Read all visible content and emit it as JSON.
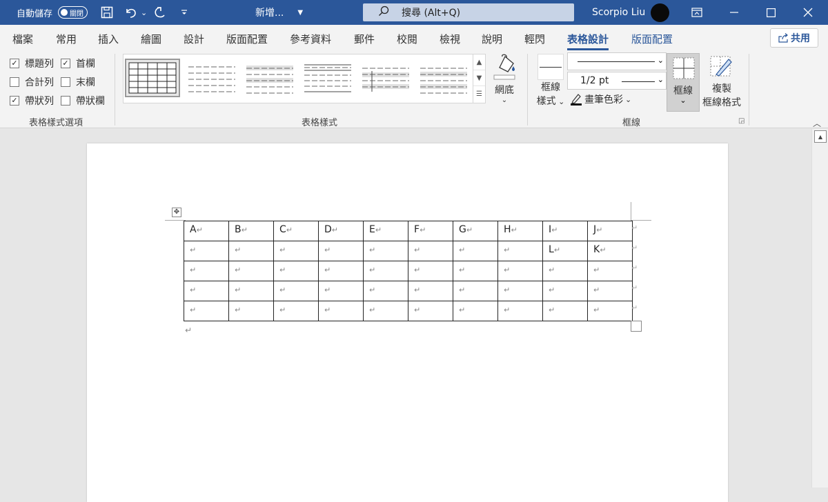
{
  "titlebar": {
    "autosave_label": "自動儲存",
    "autosave_toggle": "關閉",
    "document_name": "新增...",
    "search_placeholder": "搜尋 (Alt+Q)",
    "user_name": "Scorpio Liu",
    "icons": {
      "save": "save-icon",
      "undo": "undo-icon",
      "redo": "redo-icon",
      "minimize": "minimize-icon",
      "maximize": "maximize-icon",
      "close": "close-icon",
      "ribbon_options": "ribbon-display-icon"
    }
  },
  "tabs": [
    {
      "label": "檔案"
    },
    {
      "label": "常用"
    },
    {
      "label": "插入"
    },
    {
      "label": "繪圖"
    },
    {
      "label": "設計"
    },
    {
      "label": "版面配置"
    },
    {
      "label": "參考資料"
    },
    {
      "label": "郵件"
    },
    {
      "label": "校閱"
    },
    {
      "label": "檢視"
    },
    {
      "label": "說明"
    },
    {
      "label": "輕閃"
    },
    {
      "label": "表格設計"
    },
    {
      "label": "版面配置"
    }
  ],
  "share_label": "共用",
  "style_options": {
    "group_label": "表格樣式選項",
    "items": [
      {
        "label": "標題列",
        "checked": true
      },
      {
        "label": "首欄",
        "checked": true
      },
      {
        "label": "合計列",
        "checked": false
      },
      {
        "label": "末欄",
        "checked": false
      },
      {
        "label": "帶狀列",
        "checked": true
      },
      {
        "label": "帶狀欄",
        "checked": false
      }
    ]
  },
  "table_styles": {
    "group_label": "表格樣式",
    "shading_label": "網底"
  },
  "borders": {
    "group_label": "框線",
    "border_styles_label_1": "框線",
    "border_styles_label_2": "樣式",
    "line_weight": "1/2 pt",
    "pen_color_label": "畫筆色彩",
    "borders_label": "框線",
    "painter_label_1": "複製",
    "painter_label_2": "框線格式"
  },
  "document": {
    "table": [
      [
        "A",
        "B",
        "C",
        "D",
        "E",
        "F",
        "G",
        "H",
        "I",
        "J"
      ],
      [
        "",
        "",
        "",
        "",
        "",
        "",
        "",
        "",
        "L",
        "K"
      ],
      [
        "",
        "",
        "",
        "",
        "",
        "",
        "",
        "",
        "",
        ""
      ],
      [
        "",
        "",
        "",
        "",
        "",
        "",
        "",
        "",
        "",
        ""
      ],
      [
        "",
        "",
        "",
        "",
        "",
        "",
        "",
        "",
        "",
        ""
      ]
    ]
  }
}
